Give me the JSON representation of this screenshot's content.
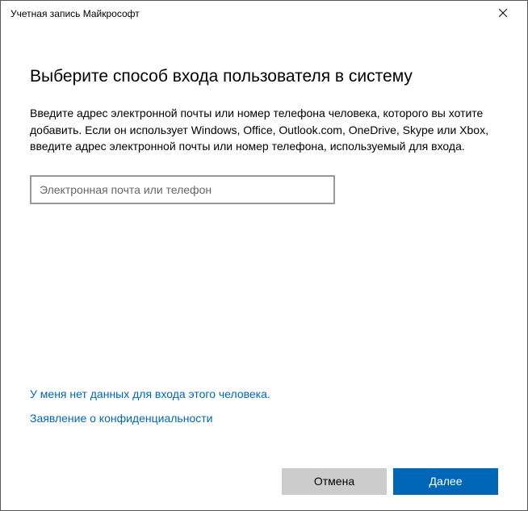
{
  "titlebar": {
    "title": "Учетная запись Майкрософт"
  },
  "main": {
    "heading": "Выберите способ входа пользователя в систему",
    "description": "Введите адрес электронной почты или номер телефона человека, которого вы хотите добавить. Если он использует Windows, Office, Outlook.com, OneDrive, Skype или Xbox, введите адрес электронной почты или номер телефона, используемый для входа.",
    "input_placeholder": "Электронная почта или телефон",
    "input_value": ""
  },
  "links": {
    "no_signin_info": "У меня нет данных для входа этого человека.",
    "privacy": "Заявление о конфиденциальности"
  },
  "footer": {
    "cancel": "Отмена",
    "next": "Далее"
  }
}
